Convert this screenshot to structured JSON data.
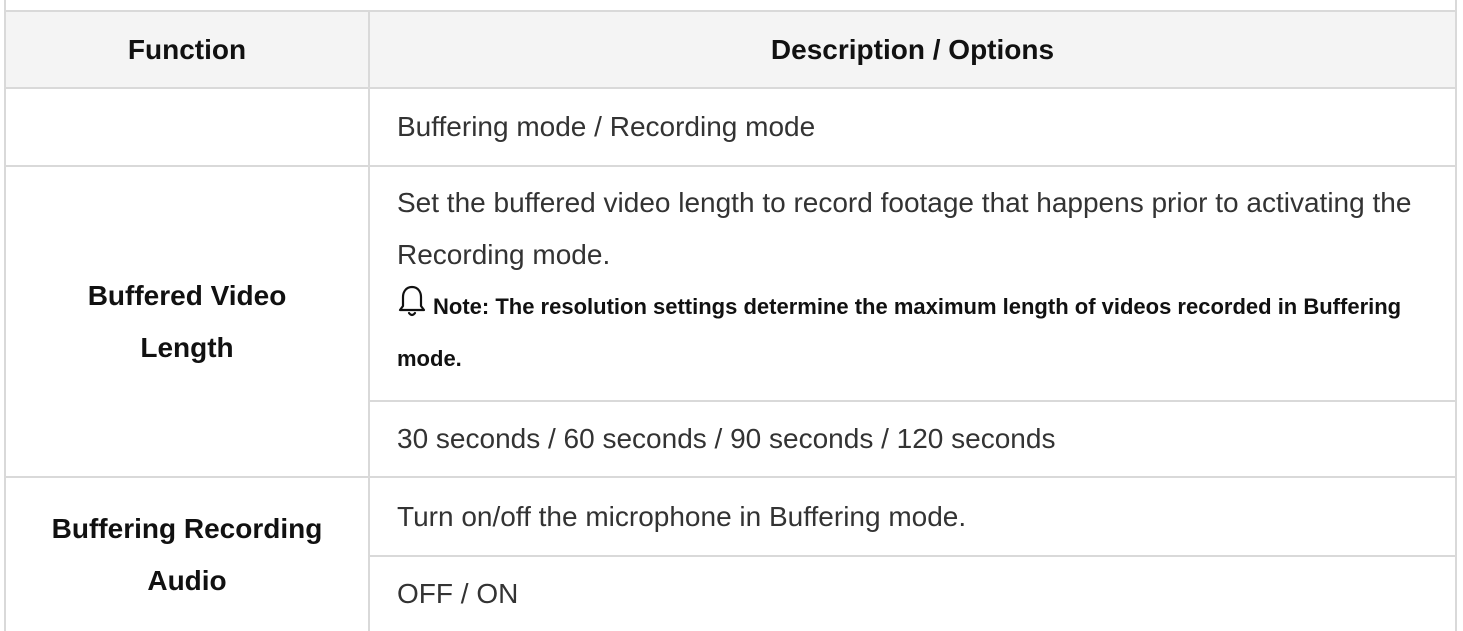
{
  "table": {
    "headers": {
      "function": "Function",
      "description": "Description / Options"
    },
    "rows": [
      {
        "function": "",
        "description": "Buffering mode / Recording mode"
      },
      {
        "function": "Buffered Video Length",
        "description": "Set the buffered video length to record footage that happens prior to activating the Recording mode.",
        "note_label": "Note: The resolution settings determine the maximum length of videos recorded in Buffering mode.",
        "note_icon": "bell-icon",
        "options": "30 seconds / 60 seconds / 90 seconds / 120 seconds"
      },
      {
        "function": "Buffering Recording Audio",
        "description": "Turn on/off the microphone in Buffering mode.",
        "options": "OFF / ON"
      }
    ]
  }
}
